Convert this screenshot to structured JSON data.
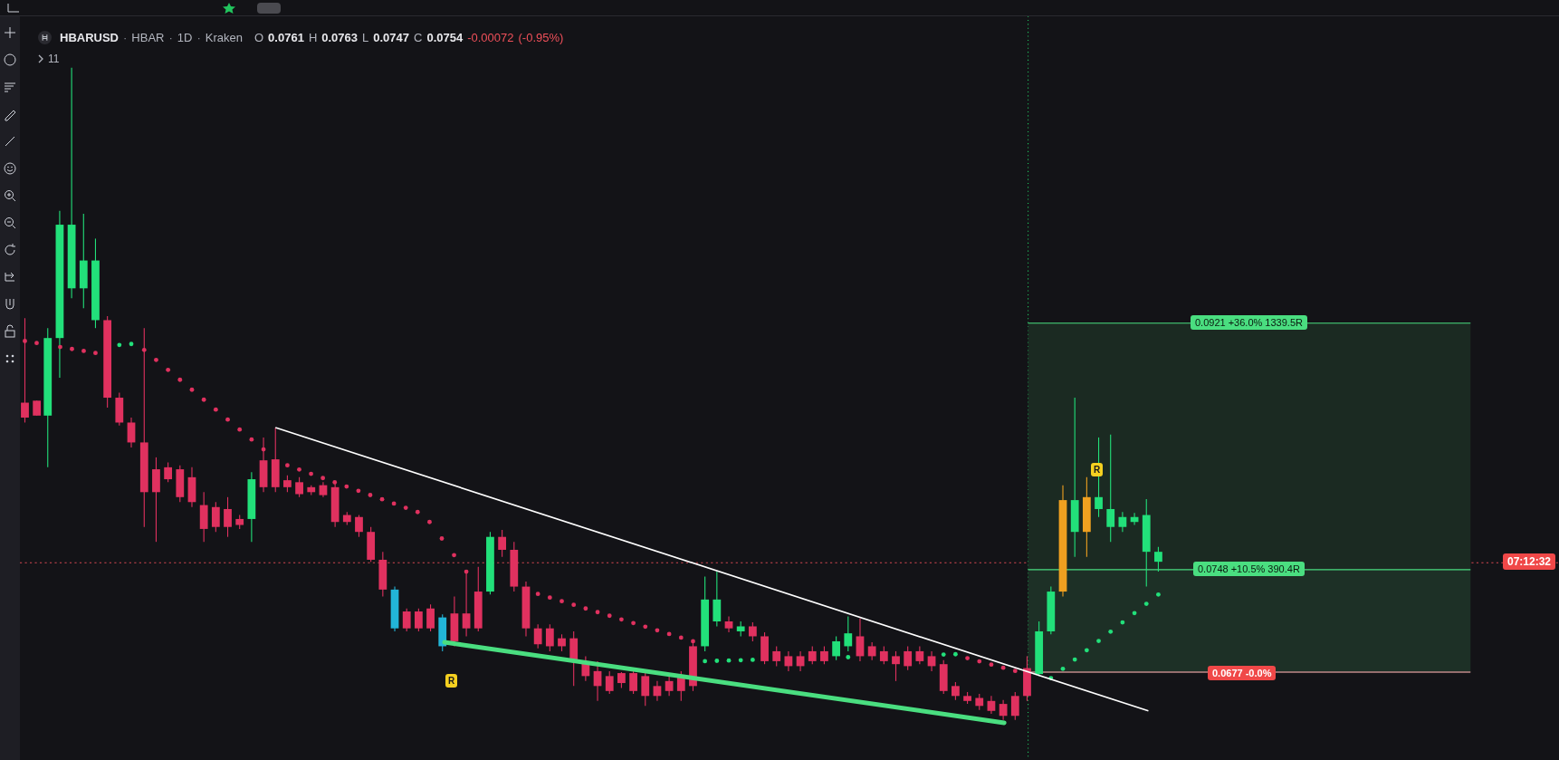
{
  "legend": {
    "symbol": "HBARUSD",
    "details": [
      {
        "separator": "·",
        "text": "HBAR"
      },
      {
        "separator": "·",
        "text": "1D"
      },
      {
        "separator": "·",
        "text": "Kraken"
      }
    ],
    "ohlc": [
      {
        "label": "O",
        "value": "0.0761"
      },
      {
        "label": "H",
        "value": "0.0763"
      },
      {
        "label": "L",
        "value": "0.0747"
      },
      {
        "label": "C",
        "value": "0.0754"
      }
    ],
    "change": "-0.00072",
    "change_pct": "(-0.95%)",
    "indicators_toggle": "11"
  },
  "position": {
    "target": "0.0921 +36.0% 1339.5R",
    "entry": "0.0748 +10.5% 390.4R",
    "stop": "0.0677 -0.0%"
  },
  "countdown": "07:12:32",
  "markers": [
    {
      "label": "R"
    },
    {
      "label": "R"
    }
  ]
}
